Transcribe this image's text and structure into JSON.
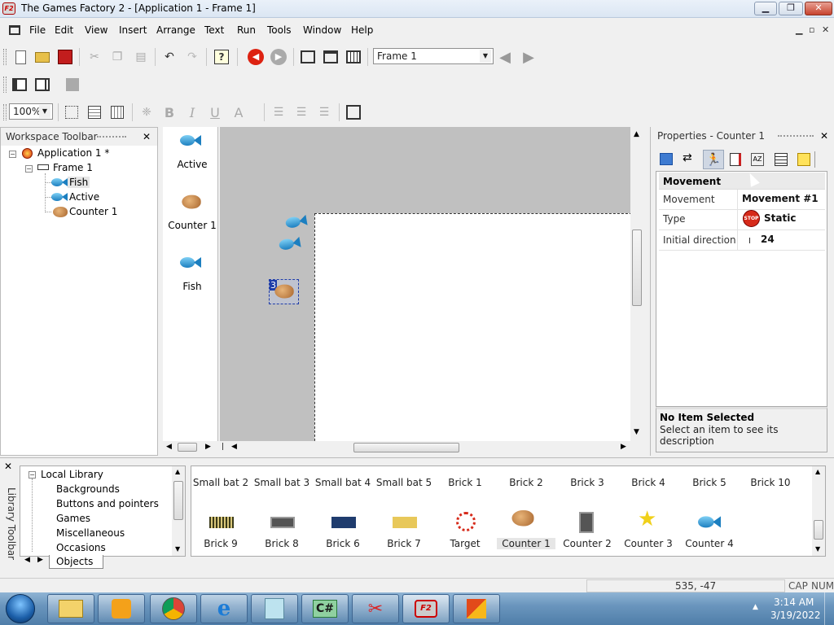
{
  "window": {
    "title": "The Games Factory 2 - [Application 1 - Frame 1]",
    "app_icon_text": "F2"
  },
  "caption_buttons": {
    "minimize": "▁",
    "maximize": "❐",
    "close": "✕"
  },
  "menu": {
    "items": [
      "File",
      "Edit",
      "View",
      "Insert",
      "Arrange",
      "Text",
      "Run",
      "Tools",
      "Window",
      "Help"
    ],
    "mdi_controls": [
      "▁",
      "▫",
      "✕"
    ]
  },
  "toolbar": {
    "frame_combo": "Frame 1",
    "zoom_combo": "100%"
  },
  "workspace": {
    "title": "Workspace Toolbar",
    "tree": [
      "Application 1 *",
      "Frame 1",
      "Fish",
      "Active",
      "Counter 1"
    ]
  },
  "object_strip": {
    "items": [
      "Active",
      "Counter 1",
      "Fish"
    ]
  },
  "canvas": {
    "counter_value": "3"
  },
  "properties": {
    "title": "Properties - Counter 1",
    "section": "Movement",
    "rows": [
      {
        "key": "Movement",
        "value": "Movement #1"
      },
      {
        "key": "Type",
        "value": "Static"
      },
      {
        "key": "Initial direction",
        "value": "24"
      }
    ],
    "stop_icon_text": "STOP",
    "desc_title": "No Item Selected",
    "desc_text": "Select an item to see its description"
  },
  "library": {
    "side_label": "Library Toolbar",
    "tree_root": "Local Library",
    "tree": [
      "Backgrounds",
      "Buttons and pointers",
      "Games",
      "Miscellaneous",
      "Occasions"
    ],
    "tab": "Objects",
    "row1": [
      "Small bat 2",
      "Small bat 3",
      "Small bat 4",
      "Small bat 5",
      "Brick 1",
      "Brick 2",
      "Brick 3",
      "Brick 4",
      "Brick 5",
      "Brick 10"
    ],
    "row2": [
      "Brick 9",
      "Brick 8",
      "Brick 6",
      "Brick 7",
      "Target",
      "Counter 1",
      "Counter 2",
      "Counter 3",
      "Counter 4"
    ]
  },
  "statusbar": {
    "coords": "535, -47",
    "cap": "CAP",
    "num": "NUM"
  },
  "taskbar": {
    "time": "3:14 AM",
    "date": "3/19/2022",
    "ie_label": "e",
    "cs_label": "C#",
    "f2_label": "F2"
  }
}
